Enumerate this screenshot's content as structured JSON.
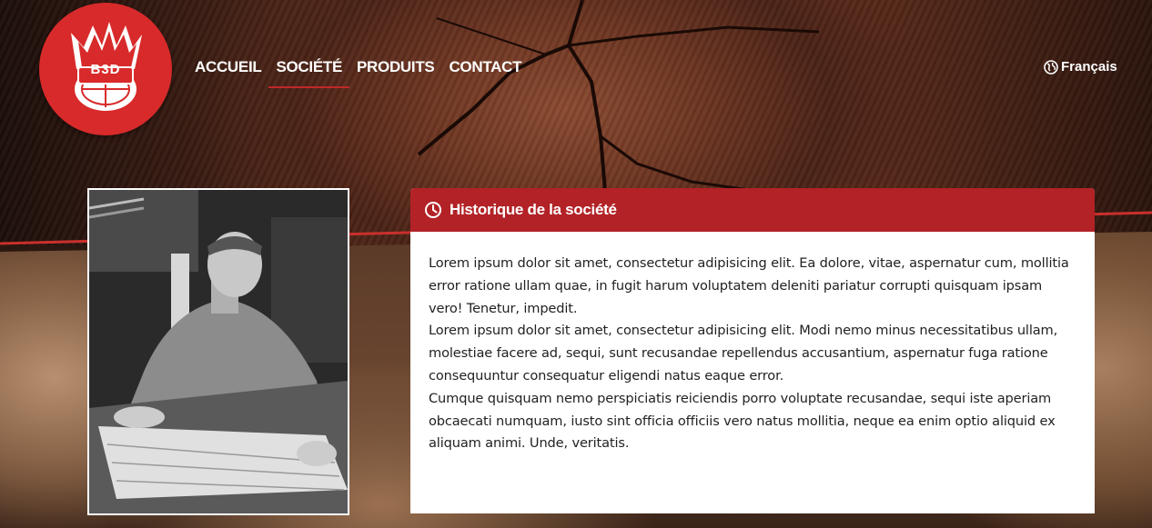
{
  "brand": {
    "logo_text": "B3D"
  },
  "nav": {
    "items": [
      {
        "label": "ACCUEIL",
        "active": false
      },
      {
        "label": "SOCIÉTÉ",
        "active": true
      },
      {
        "label": "PRODUITS",
        "active": false
      },
      {
        "label": "CONTACT",
        "active": false
      }
    ]
  },
  "language": {
    "label": "Français",
    "icon": "globe-icon"
  },
  "panel": {
    "icon": "clock-icon",
    "title": "Historique de la société",
    "paragraphs": [
      "Lorem ipsum dolor sit amet, consectetur adipisicing elit. Ea dolore, vitae, aspernatur cum, mollitia error ratione ullam quae, in fugit harum voluptatem deleniti pariatur corrupti quisquam ipsam vero! Tenetur, impedit.",
      "Lorem ipsum dolor sit amet, consectetur adipisicing elit. Modi nemo minus necessitatibus ullam, molestiae facere ad, sequi, sunt recusandae repellendus accusantium, aspernatur fuga ratione consequuntur consequatur eligendi natus eaque error.",
      "Cumque quisquam nemo perspiciatis reiciendis porro voluptate recusandae, sequi iste aperiam obcaecati numquam, iusto sint officia officiis vero natus mollitia, neque ea enim optio aliquid ex aliquam animi. Unde, veritatis."
    ]
  },
  "colors": {
    "accent": "#b22226",
    "logo": "#d82a2a",
    "text": "#222222"
  }
}
